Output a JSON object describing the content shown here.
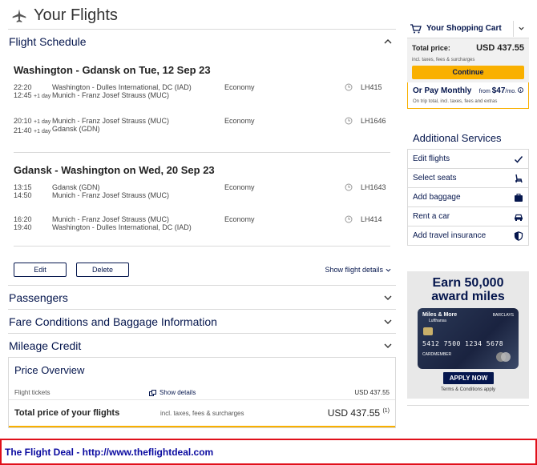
{
  "page": {
    "title": "Your Flights"
  },
  "schedule": {
    "title": "Flight Schedule",
    "outbound": {
      "route": "Washington - Gdansk on Tue, 12 Sep 23",
      "legs": [
        {
          "dep_time": "22:20",
          "arr_time": "12:45",
          "arr_day": "+1 day",
          "from": "Washington - Dulles International, DC (IAD)",
          "to": "Munich - Franz Josef Strauss (MUC)",
          "cabin": "Economy",
          "flight": "LH415"
        },
        {
          "dep_time": "20:10",
          "dep_day": "+1 day",
          "arr_time": "21:40",
          "arr_day": "+1 day",
          "from": "Munich - Franz Josef Strauss (MUC)",
          "to": "Gdansk (GDN)",
          "cabin": "Economy",
          "flight": "LH1646"
        }
      ]
    },
    "inbound": {
      "route": "Gdansk - Washington on Wed, 20 Sep 23",
      "legs": [
        {
          "dep_time": "13:15",
          "arr_time": "14:50",
          "from": "Gdansk (GDN)",
          "to": "Munich - Franz Josef Strauss (MUC)",
          "cabin": "Economy",
          "flight": "LH1643"
        },
        {
          "dep_time": "16:20",
          "arr_time": "19:40",
          "from": "Munich - Franz Josef Strauss (MUC)",
          "to": "Washington - Dulles International, DC (IAD)",
          "cabin": "Economy",
          "flight": "LH414"
        }
      ]
    },
    "edit_label": "Edit",
    "delete_label": "Delete",
    "show_details_label": "Show flight details"
  },
  "sections": {
    "passengers": "Passengers",
    "fare": "Fare Conditions and Baggage Information",
    "mileage": "Mileage Credit"
  },
  "price_overview": {
    "title": "Price Overview",
    "tickets_label": "Flight tickets",
    "show_details": "Show details",
    "tickets_amount": "USD 437.55",
    "total_label": "Total price of your flights",
    "total_incl": "incl. taxes, fees & surcharges",
    "total_amount": "USD 437.55",
    "total_note": "(1)"
  },
  "cart": {
    "title": "Your Shopping Cart",
    "total_label": "Total price:",
    "total_value": "USD 437.55",
    "incl_note": "incl. taxes, fees & surcharges",
    "continue_label": "Continue",
    "pay_monthly": "Or Pay Monthly",
    "from_label": "from",
    "monthly_amount": "$47",
    "per_month": "/mo.",
    "monthly_note": "On trip total, incl. taxes, fees and extras"
  },
  "services": {
    "title": "Additional Services",
    "items": [
      "Edit flights",
      "Select seats",
      "Add baggage",
      "Rent a car",
      "Add travel insurance"
    ]
  },
  "ad": {
    "headline1": "Earn 50,000",
    "headline2": "award miles",
    "card_brand": "Miles & More",
    "card_brand2": "Lufthansa",
    "card_bank": "BARCLAYS",
    "card_number": "5412 7500 1234 5678",
    "card_holder": "CARDMEMBER",
    "apply_label": "APPLY NOW",
    "terms": "Terms & Conditions apply"
  },
  "footer": {
    "text": "The Flight Deal - http://www.theflightdeal.com"
  },
  "colors": {
    "brand": "#05164d",
    "accent": "#f9b000",
    "footer_border": "#e0101a",
    "footer_text": "#0a0aa0"
  }
}
